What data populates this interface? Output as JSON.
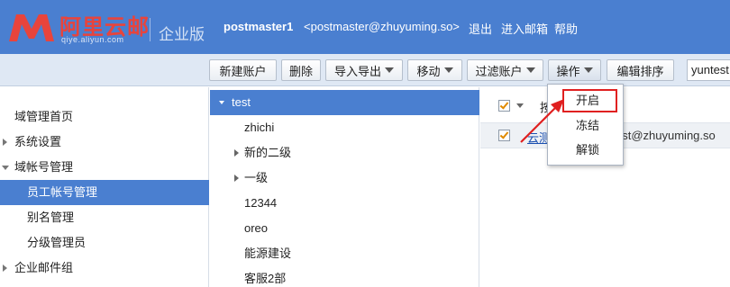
{
  "header": {
    "brand": "阿里云邮",
    "brand_sub": "qiye.aliyun.com",
    "edition": "企业版",
    "user_name": "postmaster1",
    "user_email": "<postmaster@zhuyuming.so>",
    "links": [
      "退出",
      "进入邮箱",
      "帮助"
    ]
  },
  "toolbar": {
    "buttons": [
      "新建账户",
      "删除",
      "导入导出",
      "移动",
      "过滤账户",
      "操作",
      "编辑排序"
    ],
    "search_value": "yuntest"
  },
  "leftnav": {
    "items": [
      "域管理首页",
      "系统设置",
      "域帐号管理",
      "员工帐号管理",
      "别名管理",
      "分级管理员",
      "企业邮件组"
    ]
  },
  "orgtree": {
    "items": [
      "test",
      "zhichi",
      "新的二级",
      "一级",
      "12344",
      "oreo",
      "能源建设",
      "客服2部"
    ]
  },
  "list": {
    "header_label": "按",
    "row_name": "云测",
    "row_email": "est@zhuyuming.so"
  },
  "dropdown": {
    "items": [
      "开启",
      "冻结",
      "解锁"
    ]
  },
  "colors": {
    "header_bg": "#4a7fd0",
    "selection": "#4a7fd0",
    "brand_red": "#e8443c",
    "highlight_red": "#e02020"
  }
}
